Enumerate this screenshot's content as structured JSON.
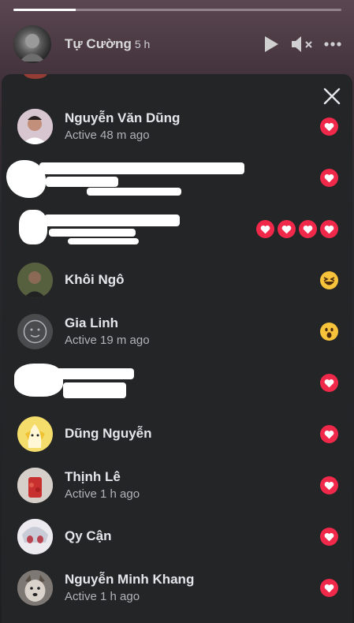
{
  "story": {
    "author": "Tự Cường",
    "time": "5 h",
    "progress": 0.19
  },
  "viewers": [
    {
      "name": "Nguyễn Văn Dũng",
      "status": "Active 48 m ago",
      "avatar_icon": "person-photo-icon",
      "reactions": [
        "love"
      ]
    },
    {
      "name": "",
      "status": "",
      "avatar_icon": "redacted",
      "reactions": [
        "love"
      ],
      "redacted": true
    },
    {
      "name": "",
      "status": "",
      "avatar_icon": "redacted",
      "reactions": [
        "love",
        "love",
        "love",
        "love"
      ],
      "redacted": true
    },
    {
      "name": "Khôi Ngô",
      "status": "",
      "avatar_icon": "person-photo-icon",
      "reactions": [
        "haha"
      ]
    },
    {
      "name": "Gia Linh",
      "status": "Active 19 m ago",
      "avatar_icon": "default-avatar-icon",
      "reactions": [
        "wow"
      ]
    },
    {
      "name": "",
      "status": "",
      "avatar_icon": "redacted",
      "reactions": [
        "love"
      ],
      "redacted": true
    },
    {
      "name": "Dũng Nguyễn",
      "status": "",
      "avatar_icon": "banana-avatar-icon",
      "reactions": [
        "love"
      ]
    },
    {
      "name": "Thịnh Lê",
      "status": "Active 1 h ago",
      "avatar_icon": "drink-photo-icon",
      "reactions": [
        "love"
      ]
    },
    {
      "name": "Qy Cận",
      "status": "",
      "avatar_icon": "anime-avatar-icon",
      "reactions": [
        "love"
      ]
    },
    {
      "name": "Nguyễn Minh Khang",
      "status": "Active 1 h ago",
      "avatar_icon": "dog-photo-icon",
      "reactions": [
        "love"
      ]
    }
  ],
  "colors": {
    "sheet_bg": "#242526",
    "love": "#f0284a",
    "haha": "#f7c33b",
    "secondary_text": "#b0b3b8"
  },
  "icons": {
    "play": "play-icon",
    "mute": "speaker-muted-icon",
    "more": "more-dots-icon",
    "close": "close-icon"
  }
}
